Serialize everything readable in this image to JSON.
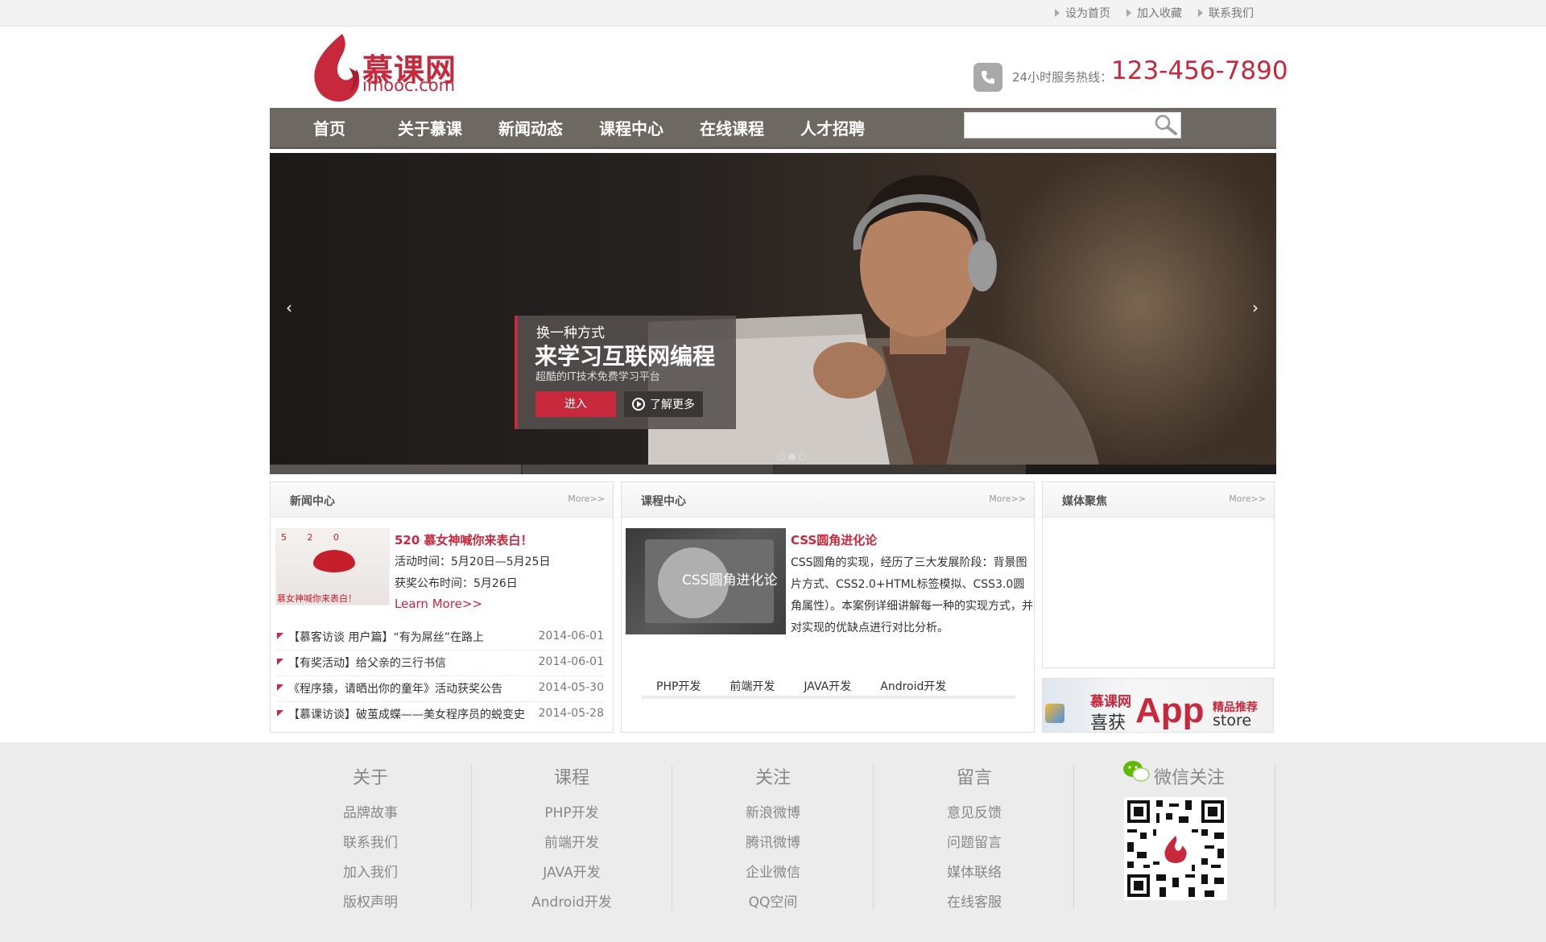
{
  "toplinks": [
    "设为首页",
    "加入收藏",
    "联系我们"
  ],
  "brand": {
    "name": "慕课网",
    "domain": "imooc.com",
    "color": "#c8283c"
  },
  "hotline": {
    "label": "24小时服务热线：",
    "number": "123-456-7890"
  },
  "nav": [
    "首页",
    "关于慕课",
    "新闻动态",
    "课程中心",
    "在线课程",
    "人才招聘"
  ],
  "search": {
    "placeholder": "",
    "icon": "search-icon"
  },
  "banner": {
    "line1": "换一种方式",
    "line2": "来学习互联网编程",
    "line3": "超酷的IT技术免费学习平台",
    "enter": "进入",
    "learn_more": "了解更多",
    "prev": "‹",
    "next": "›",
    "active_slide": 2
  },
  "news": {
    "title": "新闻中心",
    "more": "More>>",
    "image_text_top": "5 2 0",
    "image_text_bottom": "慕女神喊你来表白！",
    "headline": "520 慕女神喊你来表白！",
    "activity_time": "活动时间：5月20日—5月25日",
    "announce_time": "获奖公布时间：5月26日",
    "learn_more": "Learn More>>",
    "items": [
      {
        "title": "【慕客访谈 用户篇】“有为屌丝”在路上",
        "date": "2014-06-01"
      },
      {
        "title": "【有奖活动】给父亲的三行书信",
        "date": "2014-06-01"
      },
      {
        "title": "《程序猿，请晒出你的童年》活动获奖公告",
        "date": "2014-05-30"
      },
      {
        "title": "【慕课访谈】破茧成蝶——美女程序员的蜕变史",
        "date": "2014-05-28"
      }
    ]
  },
  "courses": {
    "title": "课程中心",
    "more": "More>>",
    "image_text": "CSS圆角进化论",
    "headline": "CSS圆角进化论",
    "desc": "CSS圆角的实现，经历了三大发展阶段：背景图片方式、CSS2.0+HTML标签模拟、CSS3.0圆角属性）。本案例详细讲解每一种的实现方式，并对实现的优缺点进行对比分析。",
    "tabs": [
      "PHP开发",
      "前端开发",
      "JAVA开发",
      "Android开发"
    ]
  },
  "media": {
    "title": "媒体聚焦",
    "more": "More>>",
    "app_banner": {
      "brand": "慕课网",
      "won": "喜获",
      "app": "App",
      "rec": "精品推荐",
      "store": "store"
    }
  },
  "footer": {
    "columns": [
      {
        "title": "关于",
        "links": [
          "品牌故事",
          "联系我们",
          "加入我们",
          "版权声明"
        ]
      },
      {
        "title": "课程",
        "links": [
          "PHP开发",
          "前端开发",
          "JAVA开发",
          "Android开发"
        ]
      },
      {
        "title": "关注",
        "links": [
          "新浪微博",
          "腾讯微博",
          "企业微信",
          "QQ空间"
        ]
      },
      {
        "title": "留言",
        "links": [
          "意见反馈",
          "问题留言",
          "媒体联络",
          "在线客服"
        ]
      }
    ],
    "wechat": "微信关注"
  }
}
